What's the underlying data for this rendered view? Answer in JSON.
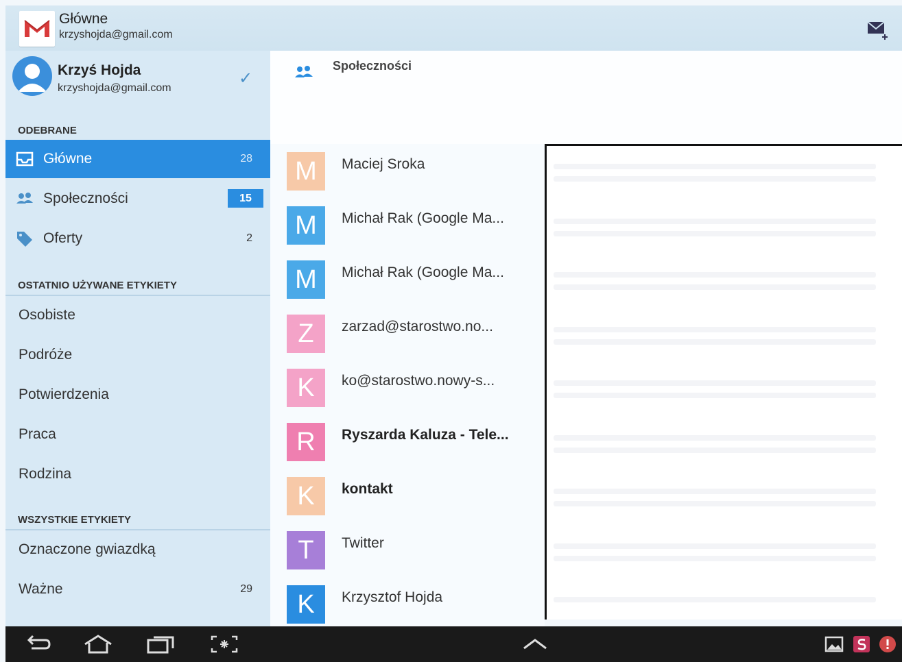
{
  "header": {
    "title": "Główne",
    "account_email": "krzyshojda@gmail.com"
  },
  "account": {
    "name": "Krzyś Hojda",
    "email": "krzyshojda@gmail.com"
  },
  "drawer": {
    "received_header": "ODEBRANE",
    "received": [
      {
        "label": "Główne",
        "count": "28"
      },
      {
        "label": "Społeczności",
        "count": "15"
      },
      {
        "label": "Oferty",
        "count": "2"
      }
    ],
    "recent_header": "OSTATNIO UŻYWANE ETYKIETY",
    "recent": [
      {
        "label": "Osobiste"
      },
      {
        "label": "Podróże"
      },
      {
        "label": "Potwierdzenia"
      },
      {
        "label": "Praca"
      },
      {
        "label": "Rodzina"
      }
    ],
    "all_header": "WSZYSTKIE ETYKIETY",
    "all": [
      {
        "label": "Oznaczone gwiazdką",
        "count": ""
      },
      {
        "label": "Ważne",
        "count": "29"
      }
    ]
  },
  "category": {
    "title": "Społeczności"
  },
  "messages": [
    {
      "initial": "M",
      "sender": "Maciej Sroka",
      "color": "#f7c9a8"
    },
    {
      "initial": "M",
      "sender": "Michał Rak (Google Ma...",
      "color": "#4aa9e8"
    },
    {
      "initial": "M",
      "sender": "Michał Rak (Google Ma...",
      "color": "#4aa9e8"
    },
    {
      "initial": "Z",
      "sender": "zarzad@starostwo.no...",
      "color": "#f4a3c8"
    },
    {
      "initial": "K",
      "sender": "ko@starostwo.nowy-s...",
      "color": "#f4a3c8"
    },
    {
      "initial": "R",
      "sender": "Ryszarda Kaluza - Tele...",
      "color": "#ef7fb0"
    },
    {
      "initial": "K",
      "sender": "kontakt",
      "color": "#f7c9a8"
    },
    {
      "initial": "T",
      "sender": "Twitter",
      "color": "#a77fd8"
    },
    {
      "initial": "K",
      "sender": "Krzysztof Hojda",
      "color": "#2a8de0"
    }
  ],
  "colors": {
    "accent": "#2a8de0",
    "drawer_bg": "#d8e9f5"
  }
}
